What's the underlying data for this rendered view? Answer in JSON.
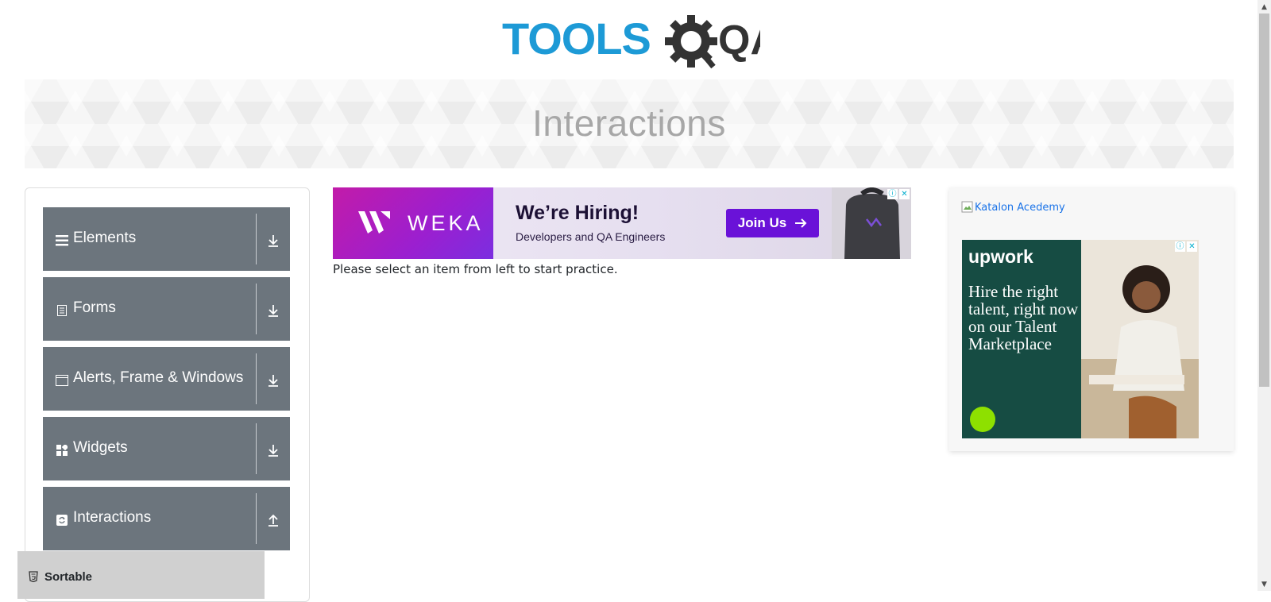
{
  "brand": {
    "logo_text_left": "TOOLS",
    "logo_text_right": "QA"
  },
  "banner": {
    "title": "Interactions"
  },
  "sidebar": {
    "groups": [
      {
        "label": "Elements",
        "icon": "hamburger-icon",
        "state": "collapsed"
      },
      {
        "label": "Forms",
        "icon": "document-icon",
        "state": "collapsed"
      },
      {
        "label": "Alerts, Frame & Windows",
        "icon": "window-icon",
        "state": "collapsed"
      },
      {
        "label": "Widgets",
        "icon": "grid-icon",
        "state": "collapsed"
      },
      {
        "label": "Interactions",
        "icon": "refresh-icon",
        "state": "expanded"
      }
    ],
    "items": [
      {
        "label": "Sortable",
        "icon": "html5-icon"
      }
    ]
  },
  "ad_top": {
    "brand": "WEKA",
    "headline": "We’re Hiring!",
    "subtext": "Developers and QA Engineers",
    "cta": "Join Us"
  },
  "main": {
    "instruction": "Please select an item from left to start practice."
  },
  "ad_side": {
    "katalon_alt": "Katalon Acedemy",
    "upwork": {
      "logo": "upwork",
      "headline": "Hire the right talent, right now on our Talent Marketplace"
    }
  },
  "colors": {
    "menu_bg": "#6c757d",
    "active_item_bg": "#d0d0d0",
    "logo_blue": "#1d9ad6",
    "logo_dark": "#333333",
    "cta_purple": "#6a12d8"
  }
}
